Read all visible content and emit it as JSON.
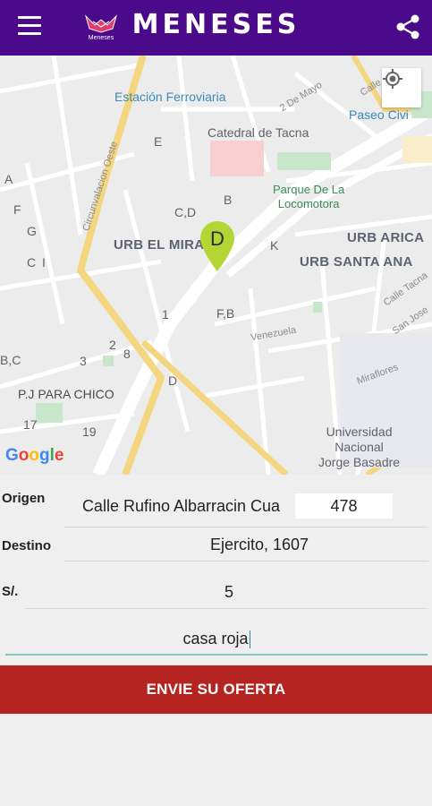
{
  "header": {
    "title": "MENESES",
    "logo_text": "Meneses"
  },
  "map": {
    "labels": {
      "estacion": "Estación Ferroviaria",
      "dos_de_mayo": "2 De Mayo",
      "calle": "Calle",
      "paseo": "Paseo Civi",
      "catedral": "Catedral de Tacna",
      "parque": "Parque De La\nLocomotora",
      "circunvalacion": "Circunvalacion Oeste",
      "urb_miral": "URB EL MIRAL",
      "urb_arica": "URB ARICA",
      "urb_santa_ana": "URB SANTA ANA",
      "calle_tacna": "Calle Tacna",
      "san_jose": "San Jose",
      "venezuela": "Venezuela",
      "miraflores": "Miraflores",
      "universidad": "Universidad\nNacional\nJorge Basadre",
      "pj_chico": "P.J PARA CHICO"
    },
    "letters": [
      "E",
      "A",
      "F",
      "G",
      "C",
      "I",
      "B",
      "C,D",
      "K",
      "F,B",
      "1",
      "2",
      "8",
      "3",
      "B,C",
      "D",
      "17",
      "19"
    ],
    "pin_letter": "D",
    "google": "Google"
  },
  "form": {
    "origen_label": "Origen",
    "origen_value": "Calle Rufino Albarracin Cua",
    "origen_number": "478",
    "destino_label": "Destino",
    "destino_value": "Ejercito, 1607",
    "price_label": "S/.",
    "price_value": "5",
    "reference_value": "casa roja",
    "submit_label": "ENVIE SU OFERTA"
  },
  "colors": {
    "header": "#4b0a8a",
    "button": "#b62422",
    "pin": "#b5d534"
  }
}
